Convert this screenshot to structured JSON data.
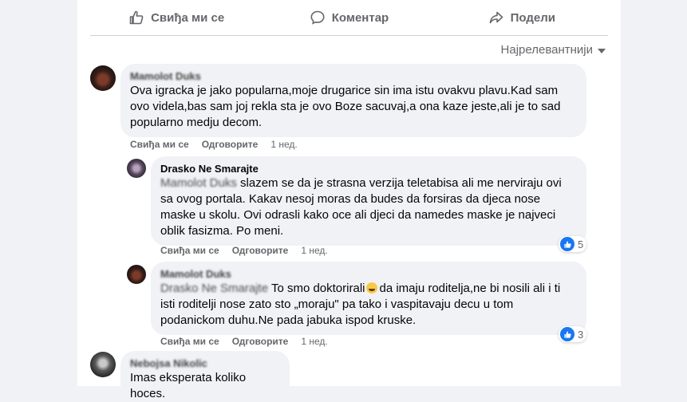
{
  "actions": {
    "like": "Свиђа ми се",
    "comment": "Коментар",
    "share": "Подели"
  },
  "sort_label": "Најрелевантнији",
  "comments": [
    {
      "author": "Mamolot Duks",
      "text": "Ova igracka je jako popularna,moje drugarice sin ima istu ovakvu plavu.Kad sam ovo videla,bas sam joj rekla sta je ovo Boze sacuvaj,a ona kaze jeste,ali je to sad popularno medju decom.",
      "like": "Свиђа ми се",
      "reply": "Одговорите",
      "time": "1 нед."
    },
    {
      "author": "Drasko Ne Smarajte",
      "mention": "Mamolot Duks",
      "text": " slazem se da je strasna verzija teletabisa ali me nerviraju ovi sa ovog portala. Kakav nesoj moras da budes da forsiras da djeca nose maske u skolu. Ovi odrasli kako oce ali djeci da namedes maske je najveci oblik fasizma. Po meni.",
      "like": "Свиђа ми се",
      "reply": "Одговорите",
      "time": "1 нед.",
      "reactions": "5"
    },
    {
      "author": "Mamolot Duks",
      "mention": "Drasko Ne Smarajte",
      "text_before": " To smo doktorirali",
      "text_after": "da imaju roditelja,ne bi nosili ali i ti isti roditelji nose zato sto „moraju\" pa tako i vaspitavaju decu u tom podanickom duhu.Ne pada jabuka ispod kruske.",
      "like": "Свиђа ми се",
      "reply": "Одговорите",
      "time": "1 нед.",
      "reactions": "3"
    },
    {
      "author": "Nebojsa Nikolic",
      "text": "Imas eksperata koliko hoces."
    }
  ],
  "colors": {
    "background": "#f0f2f5",
    "bubble": "#f0f2f5",
    "secondary_text": "#65676b",
    "like_blue": "#1877f2"
  }
}
